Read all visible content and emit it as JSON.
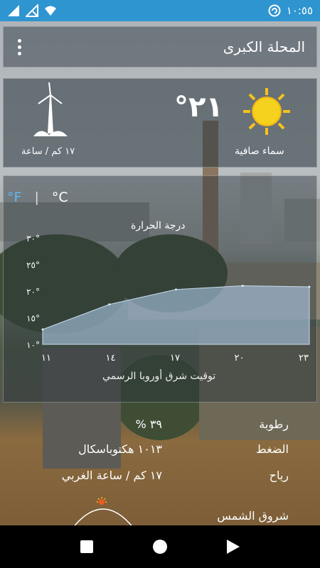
{
  "status_bar": {
    "time": "١٠:٥٥",
    "icons": [
      "signal-icon",
      "no-sim-icon",
      "wifi-icon",
      "sync-icon"
    ],
    "background_color": "#2f95d0"
  },
  "app_bar": {
    "city": "المحلة الكبرى",
    "menu_icon": "overflow-menu-icon"
  },
  "current": {
    "temperature": "٢١°",
    "condition": "سماء صافية",
    "condition_icon": "sun-icon",
    "wind_icon": "wind-turbine-icon",
    "wind": "١٧ كم / ساعة"
  },
  "units": {
    "celsius": "°C",
    "separator": "|",
    "fahrenheit": "°F",
    "selected_color": "#5fb8f5"
  },
  "chart_data": {
    "type": "area",
    "title": "درجة الحرارة",
    "x_tick_labels": [
      "١١",
      "١٤",
      "١٧",
      "٢٠",
      "٢٣"
    ],
    "x": [
      11,
      14,
      17,
      20,
      23
    ],
    "y_tick_labels": [
      "١٠°",
      "١٥°",
      "٢٠°",
      "٢٥°",
      "٣٠°"
    ],
    "y_ticks": [
      10,
      15,
      20,
      25,
      30
    ],
    "ylim": [
      10,
      30
    ],
    "series": [
      {
        "values": [
          20.8,
          21.0,
          20.3,
          17.5,
          12.8
        ]
      }
    ],
    "x_direction": "rtl",
    "fill_color": "#a9c6e2",
    "xlabel": "توقيت شرق أوروبا الرسمي"
  },
  "details": {
    "humidity_label": "رطوبة",
    "humidity_value": "٣٩ %",
    "pressure_label": "الضغط",
    "pressure_value": "١٠١٣ هكتوباسكال",
    "wind_label": "رياح",
    "wind_value": "١٧ كم / ساعة الغربي",
    "sunrise_label": "شروق الشمس"
  },
  "nav_bar": {
    "icons": [
      "recents-square-icon",
      "home-circle-icon",
      "back-triangle-icon"
    ]
  }
}
